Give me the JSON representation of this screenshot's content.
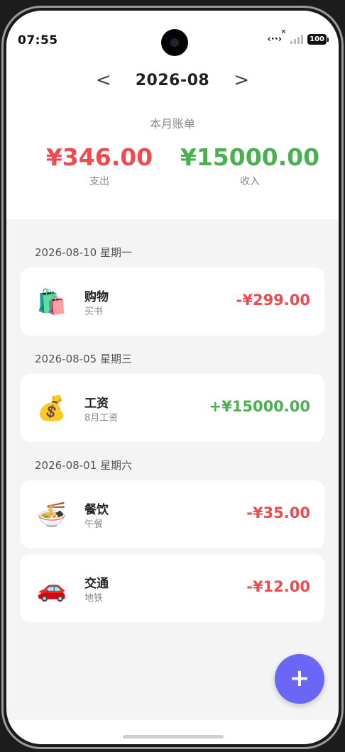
{
  "status": {
    "time": "07:55",
    "battery": "100"
  },
  "nav": {
    "month": "2026-08",
    "prev": "<",
    "next": ">"
  },
  "summary": {
    "title": "本月账单",
    "expense_amount": "¥346.00",
    "expense_label": "支出",
    "income_amount": "¥15000.00",
    "income_label": "收入"
  },
  "groups": [
    {
      "date": "2026-08-10 星期一",
      "items": [
        {
          "icon": "shopping-bags-icon",
          "emoji": "🛍️",
          "title": "购物",
          "note": "买书",
          "amount": "-¥299.00",
          "kind": "neg"
        }
      ]
    },
    {
      "date": "2026-08-05 星期三",
      "items": [
        {
          "icon": "money-bag-icon",
          "emoji": "💰",
          "title": "工资",
          "note": "8月工资",
          "amount": "+¥15000.00",
          "kind": "pos"
        }
      ]
    },
    {
      "date": "2026-08-01 星期六",
      "items": [
        {
          "icon": "noodle-bowl-icon",
          "emoji": "🍜",
          "title": "餐饮",
          "note": "午餐",
          "amount": "-¥35.00",
          "kind": "neg"
        },
        {
          "icon": "car-icon",
          "emoji": "🚗",
          "title": "交通",
          "note": "地铁",
          "amount": "-¥12.00",
          "kind": "neg"
        }
      ]
    }
  ],
  "fab": {
    "label": "+"
  },
  "colors": {
    "expense": "#ef4a4f",
    "income": "#4caf50",
    "accent": "#6b66f5"
  }
}
